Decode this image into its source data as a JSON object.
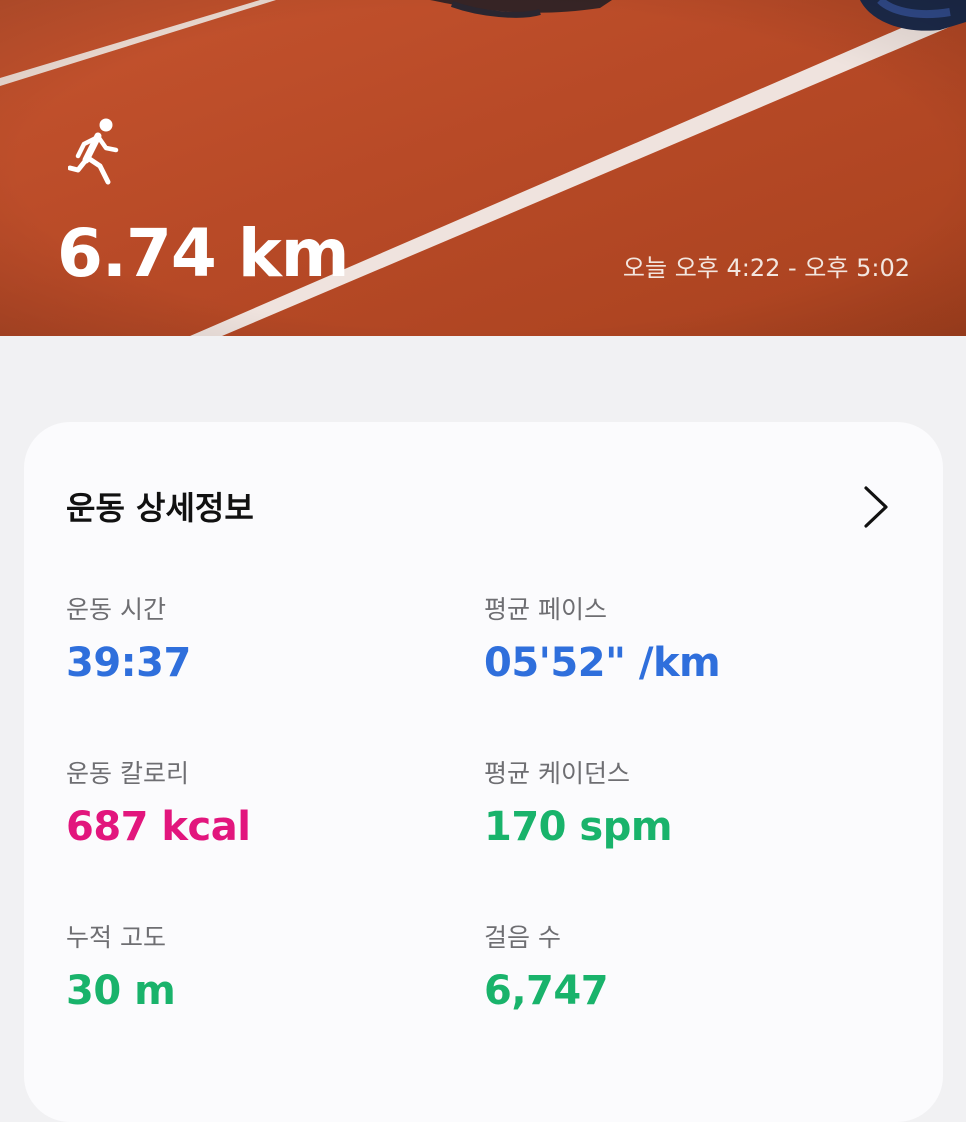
{
  "header": {
    "activity_icon": "running-person-icon",
    "distance": "6.74 km",
    "time_range": "오늘 오후 4:22 - 오후 5:02"
  },
  "details": {
    "title": "운동 상세정보",
    "chevron_icon": "chevron-right-icon",
    "metrics": [
      {
        "label": "운동 시간",
        "value": "39:37",
        "color": "#2f6fdc"
      },
      {
        "label": "평균 페이스",
        "value": "05'52\" /km",
        "color": "#2f6fdc"
      },
      {
        "label": "운동 칼로리",
        "value": "687 kcal",
        "color": "#e2167d"
      },
      {
        "label": "평균 케이던스",
        "value": "170 spm",
        "color": "#19b36b"
      },
      {
        "label": "누적 고도",
        "value": "30 m",
        "color": "#19b36b"
      },
      {
        "label": "걸음 수",
        "value": "6,747",
        "color": "#19b36b"
      }
    ]
  },
  "colors": {
    "track": "#b84a27",
    "lane_line": "#f2ece8",
    "background": "#f1f1f3",
    "card": "#fbfbfd"
  }
}
